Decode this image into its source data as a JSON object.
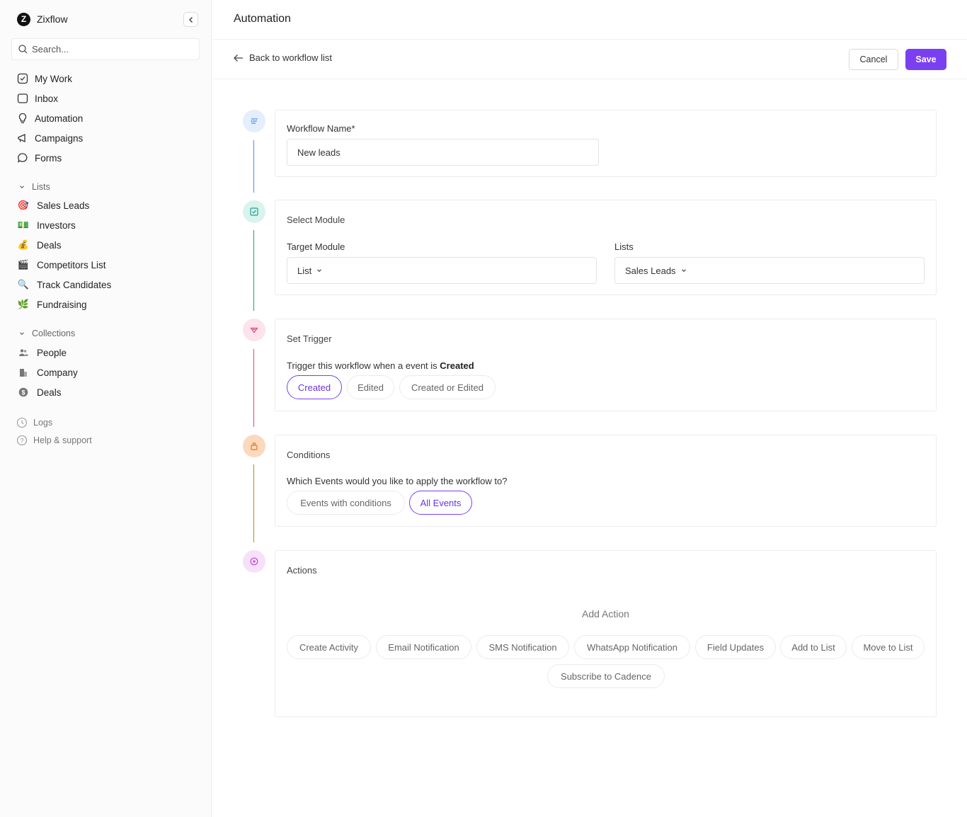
{
  "app": {
    "name": "Zixflow",
    "logo_letter": "Z"
  },
  "search": {
    "placeholder": "Search..."
  },
  "nav": [
    {
      "label": "My Work",
      "icon": "checkbox-icon"
    },
    {
      "label": "Inbox",
      "icon": "inbox-icon"
    },
    {
      "label": "Automation",
      "icon": "bulb-icon"
    },
    {
      "label": "Campaigns",
      "icon": "megaphone-icon"
    },
    {
      "label": "Forms",
      "icon": "chat-icon"
    }
  ],
  "lists": {
    "heading": "Lists",
    "items": [
      {
        "label": "Sales Leads",
        "emoji": "🎯"
      },
      {
        "label": "Investors",
        "emoji": "💵"
      },
      {
        "label": "Deals",
        "emoji": "💰"
      },
      {
        "label": "Competitors List",
        "emoji": "🎬"
      },
      {
        "label": "Track Candidates",
        "emoji": "🔍"
      },
      {
        "label": "Fundraising",
        "emoji": "🌿"
      }
    ]
  },
  "collections": {
    "heading": "Collections",
    "items": [
      {
        "label": "People",
        "icon": "people-icon"
      },
      {
        "label": "Company",
        "icon": "building-icon"
      },
      {
        "label": "Deals",
        "icon": "dollar-icon"
      }
    ]
  },
  "footer": {
    "logs": "Logs",
    "help": "Help & support"
  },
  "header": {
    "title": "Automation"
  },
  "toolbar": {
    "back_label": "Back to workflow list",
    "cancel_label": "Cancel",
    "save_label": "Save"
  },
  "colors": {
    "accent": "#7b3ff2",
    "step1": "#4a90e2",
    "step2": "#1f9e8a",
    "step3": "#e0457b",
    "step4": "#e07a1f",
    "step5": "#c04ad0"
  },
  "workflow": {
    "label": "Workflow Name*",
    "value": "New leads"
  },
  "module": {
    "title": "Select Module",
    "target_label": "Target Module",
    "target_value": "List",
    "lists_label": "Lists",
    "lists_value": "Sales Leads"
  },
  "trigger": {
    "title": "Set Trigger",
    "text_prefix": "Trigger this workflow when a event is",
    "text_value": "Created",
    "options": [
      "Created",
      "Edited",
      "Created or Edited"
    ],
    "selected": "Created"
  },
  "conditions": {
    "title": "Conditions",
    "question": "Which Events would you like to apply the workflow to?",
    "options": [
      "Events with conditions",
      "All Events"
    ],
    "selected": "All Events"
  },
  "actions": {
    "title": "Actions",
    "add_title": "Add Action",
    "options": [
      "Create Activity",
      "Email Notification",
      "SMS Notification",
      "WhatsApp Notification",
      "Field Updates",
      "Add to List",
      "Move to List",
      "Subscribe to Cadence"
    ]
  }
}
